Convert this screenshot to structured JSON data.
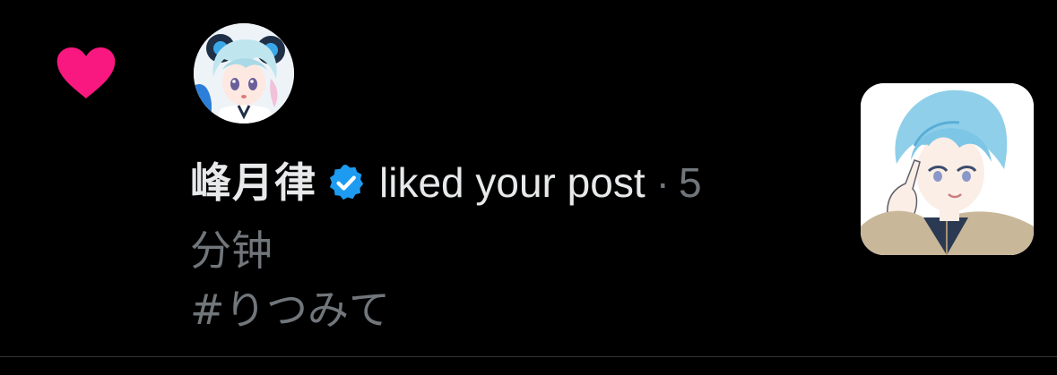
{
  "notification": {
    "type_icon": "heart-icon",
    "user_name": "峰月律",
    "verified_icon": "verified-badge-icon",
    "action_text": "liked your post",
    "separator": "·",
    "time_part1": "5",
    "time_part2": "分钟",
    "post_text": "#りつみて",
    "avatar_icon": "user-avatar",
    "thumbnail_icon": "post-thumbnail-image"
  },
  "colors": {
    "background": "#000000",
    "heart": "#f91880",
    "verified": "#1d9bf0",
    "primary_text": "#e7e9ea",
    "secondary_text": "#71767b",
    "divider": "#2f3336"
  }
}
